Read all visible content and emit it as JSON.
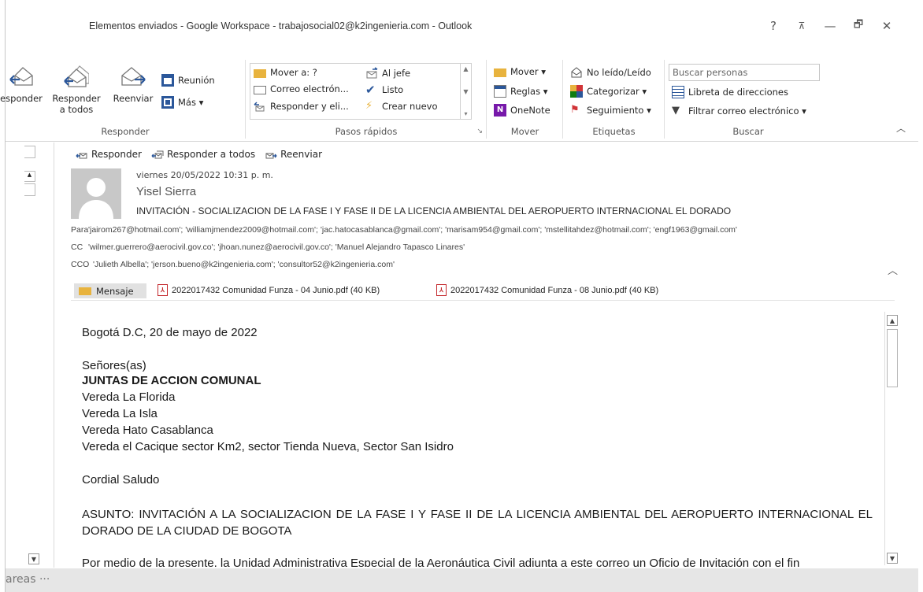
{
  "window": {
    "title": "Elementos enviados - Google Workspace - trabajosocial02@k2ingenieria.com - Outlook",
    "controls": [
      "?",
      "⊼",
      "—",
      "🗗",
      "✕"
    ]
  },
  "ribbon": {
    "responder": {
      "label": "Responder",
      "reply": "esponder",
      "reply_all_1": "Responder",
      "reply_all_2": "a todos",
      "forward": "Reenviar",
      "meeting": "Reunión",
      "more": "Más ▾"
    },
    "pasos_rapidos": {
      "label": "Pasos rápidos",
      "items": [
        "Mover a: ?",
        "Correo electrón...",
        "Responder y eli...",
        "Al jefe",
        "Listo",
        "Crear nuevo"
      ]
    },
    "mover": {
      "label": "Mover",
      "move": "Mover ▾",
      "rules": "Reglas ▾",
      "onenote": "OneNote"
    },
    "etiquetas": {
      "label": "Etiquetas",
      "unread": "No leído/Leído",
      "categorize": "Categorizar ▾",
      "followup": "Seguimiento ▾"
    },
    "buscar": {
      "label": "Buscar",
      "search_placeholder": "Buscar personas",
      "address_book": "Libreta de direcciones",
      "filter": "Filtrar correo electrónico ▾"
    }
  },
  "reading": {
    "actions": [
      "Responder",
      "Responder a todos",
      "Reenviar"
    ],
    "date": "viernes 20/05/2022 10:31 p. m.",
    "from": "Yisel Sierra",
    "subject": "INVITACIÓN - SOCIALIZACION DE LA FASE I Y FASE II DE LA LICENCIA AMBIENTAL DEL AEROPUERTO INTERNACIONAL EL DORADO",
    "to_label": "Para",
    "to": "'jairom267@hotmail.com'; 'williamjmendez2009@hotmail.com'; 'jac.hatocasablanca@gmail.com'; 'marisam954@gmail.com'; 'mstellitahdez@hotmail.com'; 'engf1963@gmail.com'",
    "cc_label": "CC",
    "cc": "'wilmer.guerrero@aerocivil.gov.co'; 'jhoan.nunez@aerocivil.gov.co'; 'Manuel Alejandro Tapasco Linares'",
    "bcc_label": "CCO",
    "bcc": "'Julieth Albella'; 'jerson.bueno@k2ingenieria.com'; 'consultor52@k2ingenieria.com'"
  },
  "attachments": {
    "message_tab": "Mensaje",
    "files": [
      "2022017432 Comunidad Funza - 04 Junio.pdf (40 KB)",
      "2022017432 Comunidad Funza - 08 Junio.pdf (40 KB)"
    ]
  },
  "body": {
    "line1": "Bogotá D.C, 20 de mayo de 2022",
    "line2": "Señores(as)",
    "line3": "JUNTAS DE ACCION COMUNAL",
    "line4": "Vereda La Florida",
    "line5": "Vereda La Isla",
    "line6": "Vereda Hato Casablanca",
    "line7": "Vereda el Cacique sector Km2, sector Tienda Nueva, Sector San Isidro",
    "line8": "Cordial Saludo",
    "asunto": "ASUNTO: INVITACIÓN A LA SOCIALIZACION DE LA FASE I Y FASE II DE LA LICENCIA AMBIENTAL DEL AEROPUERTO INTERNACIONAL EL DORADO DE LA CIUDAD DE BOGOTA",
    "cut_line": "Por medio de la presente, la Unidad Administrativa Especial de la Aeronáutica Civil adjunta a este correo un Oficio de Invitación con el fin"
  },
  "footer": {
    "text": "areas  ···"
  },
  "colors": {
    "accent_blue": "#2b579a",
    "pdf_red": "#c4282c",
    "flag_red": "#d13438",
    "folder_yellow": "#e8b33e"
  }
}
